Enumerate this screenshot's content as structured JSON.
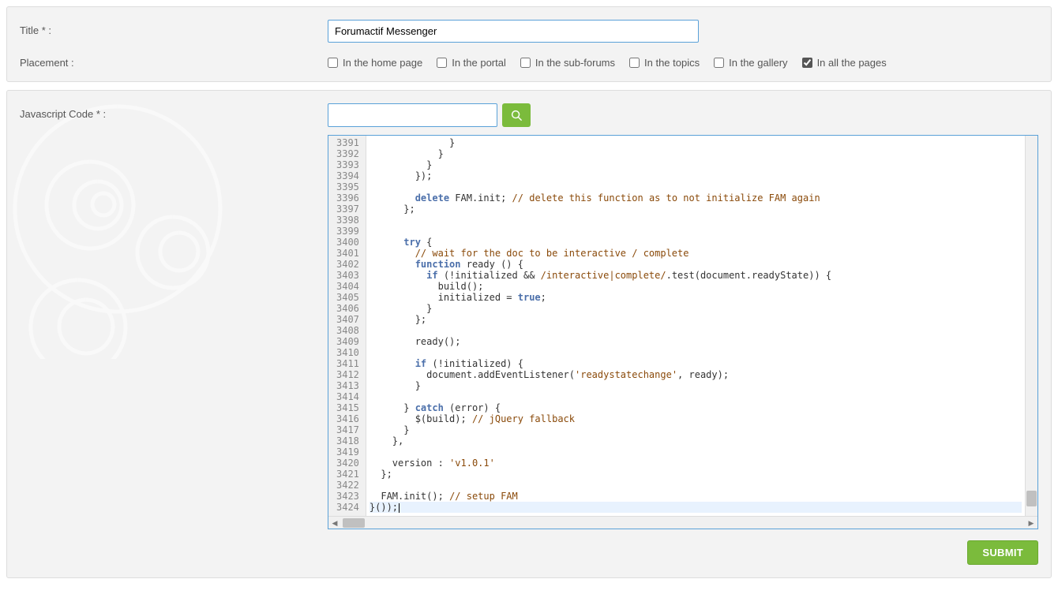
{
  "labels": {
    "title": "Title * :",
    "placement": "Placement :",
    "jscode": "Javascript Code * :"
  },
  "title_value": "Forumactif Messenger",
  "placement": {
    "home": {
      "label": "In the home page",
      "checked": false
    },
    "portal": {
      "label": "In the portal",
      "checked": false
    },
    "subforums": {
      "label": "In the sub-forums",
      "checked": false
    },
    "topics": {
      "label": "In the topics",
      "checked": false
    },
    "gallery": {
      "label": "In the gallery",
      "checked": false
    },
    "all": {
      "label": "In all the pages",
      "checked": true
    }
  },
  "buttons": {
    "submit": "SUBMIT"
  },
  "editor": {
    "first_line": 3391,
    "last_line": 3424,
    "active_line": 3424,
    "lines": [
      {
        "n": 3391,
        "t": "              }"
      },
      {
        "n": 3392,
        "t": "            }"
      },
      {
        "n": 3393,
        "t": "          }"
      },
      {
        "n": 3394,
        "t": "        });"
      },
      {
        "n": 3395,
        "t": ""
      },
      {
        "n": 3396,
        "t": "        delete FAM.init; // delete this function as to not initialize FAM again"
      },
      {
        "n": 3397,
        "t": "      };"
      },
      {
        "n": 3398,
        "t": ""
      },
      {
        "n": 3399,
        "t": ""
      },
      {
        "n": 3400,
        "t": "      try {"
      },
      {
        "n": 3401,
        "t": "        // wait for the doc to be interactive / complete"
      },
      {
        "n": 3402,
        "t": "        function ready () {"
      },
      {
        "n": 3403,
        "t": "          if (!initialized && /interactive|complete/.test(document.readyState)) {"
      },
      {
        "n": 3404,
        "t": "            build();"
      },
      {
        "n": 3405,
        "t": "            initialized = true;"
      },
      {
        "n": 3406,
        "t": "          }"
      },
      {
        "n": 3407,
        "t": "        };"
      },
      {
        "n": 3408,
        "t": ""
      },
      {
        "n": 3409,
        "t": "        ready();"
      },
      {
        "n": 3410,
        "t": ""
      },
      {
        "n": 3411,
        "t": "        if (!initialized) {"
      },
      {
        "n": 3412,
        "t": "          document.addEventListener('readystatechange', ready);"
      },
      {
        "n": 3413,
        "t": "        }"
      },
      {
        "n": 3414,
        "t": ""
      },
      {
        "n": 3415,
        "t": "      } catch (error) {"
      },
      {
        "n": 3416,
        "t": "        $(build); // jQuery fallback"
      },
      {
        "n": 3417,
        "t": "      }"
      },
      {
        "n": 3418,
        "t": "    },"
      },
      {
        "n": 3419,
        "t": ""
      },
      {
        "n": 3420,
        "t": "    version : 'v1.0.1'"
      },
      {
        "n": 3421,
        "t": "  };"
      },
      {
        "n": 3422,
        "t": ""
      },
      {
        "n": 3423,
        "t": "  FAM.init(); // setup FAM"
      },
      {
        "n": 3424,
        "t": "}());"
      }
    ]
  }
}
